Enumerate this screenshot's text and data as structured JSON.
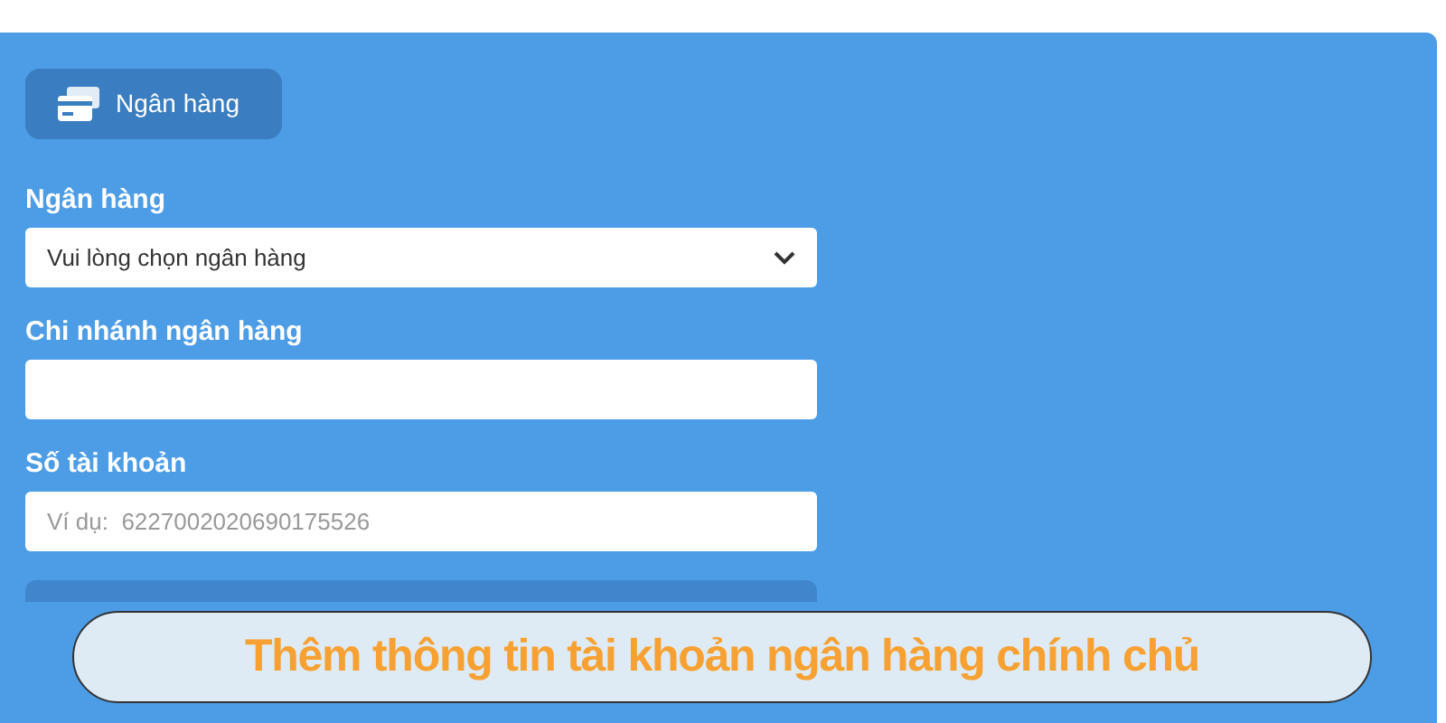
{
  "tab": {
    "label": "Ngân hàng",
    "selected": true
  },
  "fields": [
    {
      "kind": "select",
      "label": "Ngân hàng",
      "value": "Vui lòng chọn ngân hàng"
    },
    {
      "kind": "text",
      "label": "Chi nhánh ngân hàng"
    },
    {
      "kind": "text",
      "label": "Số tài khoản",
      "placeholder": "Ví dụ:  6227002020690175526"
    }
  ],
  "caption": "Thêm thông tin tài khoản ngân hàng chính chủ"
}
